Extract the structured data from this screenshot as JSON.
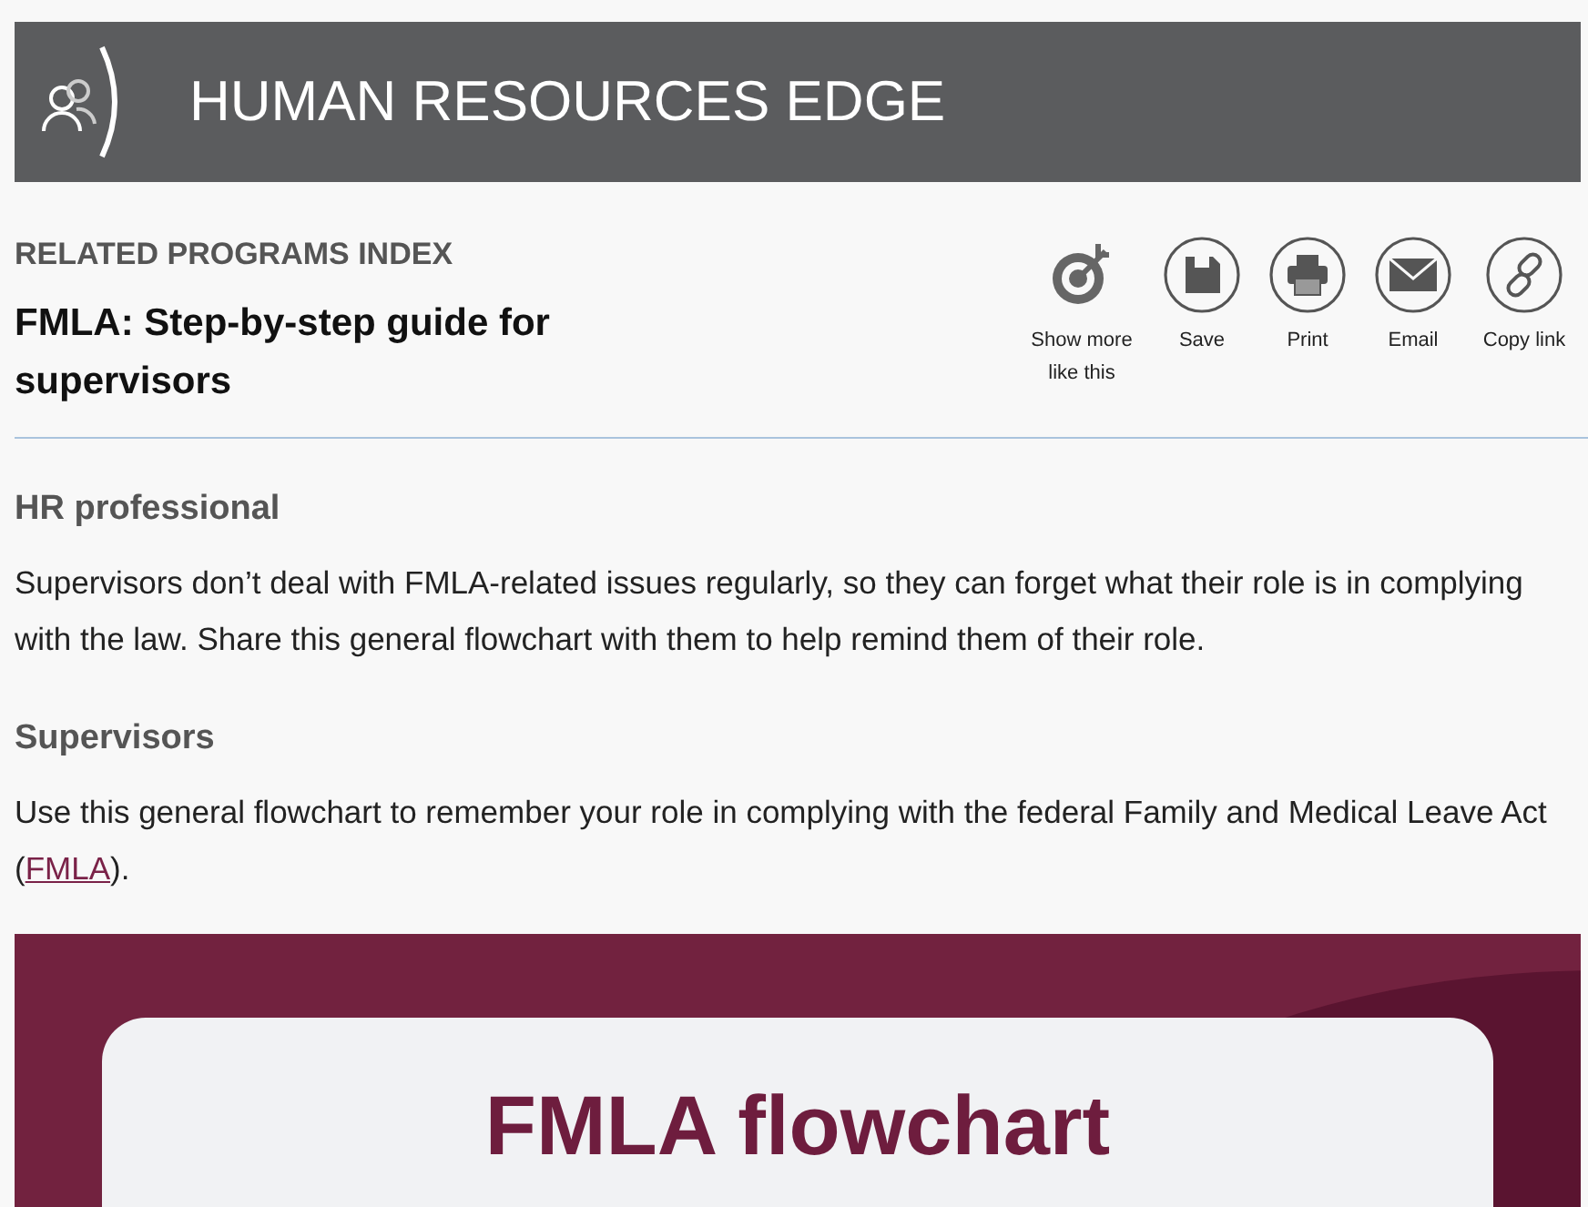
{
  "header": {
    "title": "HUMAN RESOURCES EDGE"
  },
  "article": {
    "category": "RELATED PROGRAMS INDEX",
    "title": "FMLA: Step-by-step guide for supervisors"
  },
  "actions": [
    {
      "kind": "more",
      "label": "Show more like this"
    },
    {
      "kind": "save",
      "label": "Save"
    },
    {
      "kind": "print",
      "label": "Print"
    },
    {
      "kind": "email",
      "label": "Email"
    },
    {
      "kind": "link",
      "label": "Copy link"
    }
  ],
  "sections": [
    {
      "heading": "HR professional",
      "text": "Supervisors don’t deal with FMLA-related issues regularly, so they can forget what their role is in complying with the law. Share this general flowchart with them to help remind them of their role."
    },
    {
      "heading": "Supervisors",
      "text": "Use this general flowchart to remember your role in complying with the federal Family and Medical Leave Act (",
      "link": "FMLA",
      "after": ")."
    }
  ],
  "infographic": {
    "title": "FMLA flowchart"
  }
}
